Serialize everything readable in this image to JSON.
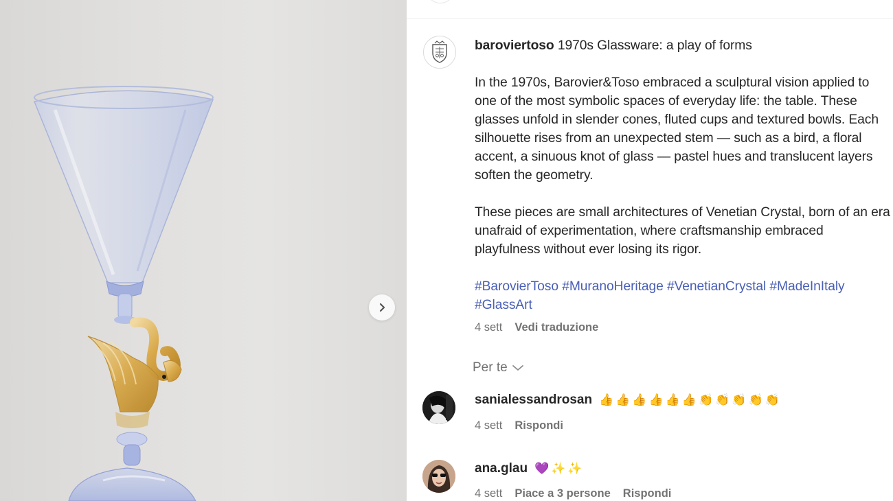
{
  "post": {
    "username": "baroviertoso",
    "title": "1970s Glassware: a play of forms",
    "paragraph_1": "In the 1970s, Barovier&Toso embraced a sculptural vision applied to one of the most symbolic spaces of everyday life: the table. These glasses unfold in slender cones, fluted cups and textured bowls. Each silhouette rises from an unexpected stem — such as a bird, a floral accent, a sinuous knot of glass — pastel hues and translucent layers soften the geometry.",
    "paragraph_2": "These pieces are small architectures of Venetian Crystal, born of an era unafraid of experimentation, where craftsmanship embraced playfulness without ever losing its rigor.",
    "hashtags": [
      "#BarovierToso",
      "#MuranoHeritage",
      "#VenetianCrystal",
      "#MadeInItaly",
      "#GlassArt"
    ],
    "time": "4 sett",
    "translate_label": "Vedi traduzione"
  },
  "filter_label": "Per te",
  "comments": [
    {
      "username": "sanialessandrosan",
      "text": "👍👍👍👍👍👍👏👏👏👏👏",
      "time": "4 sett",
      "reply_label": "Rispondi"
    },
    {
      "username": "ana.glau",
      "text": "💜✨✨",
      "time": "4 sett",
      "likes_label": "Piace a 3 persone",
      "reply_label": "Rispondi"
    }
  ],
  "icons": {
    "next": "chevron-right-icon",
    "filter": "chevron-down-icon",
    "brand_logo": "crest-logo"
  },
  "colors": {
    "hashtag": "#4a5fb5",
    "secondary_text": "#737373",
    "primary_text": "#262626",
    "photo_background": "#e1e0de",
    "glass_blue": "#b9c4e6",
    "swan_gold": "#d9a94a"
  }
}
